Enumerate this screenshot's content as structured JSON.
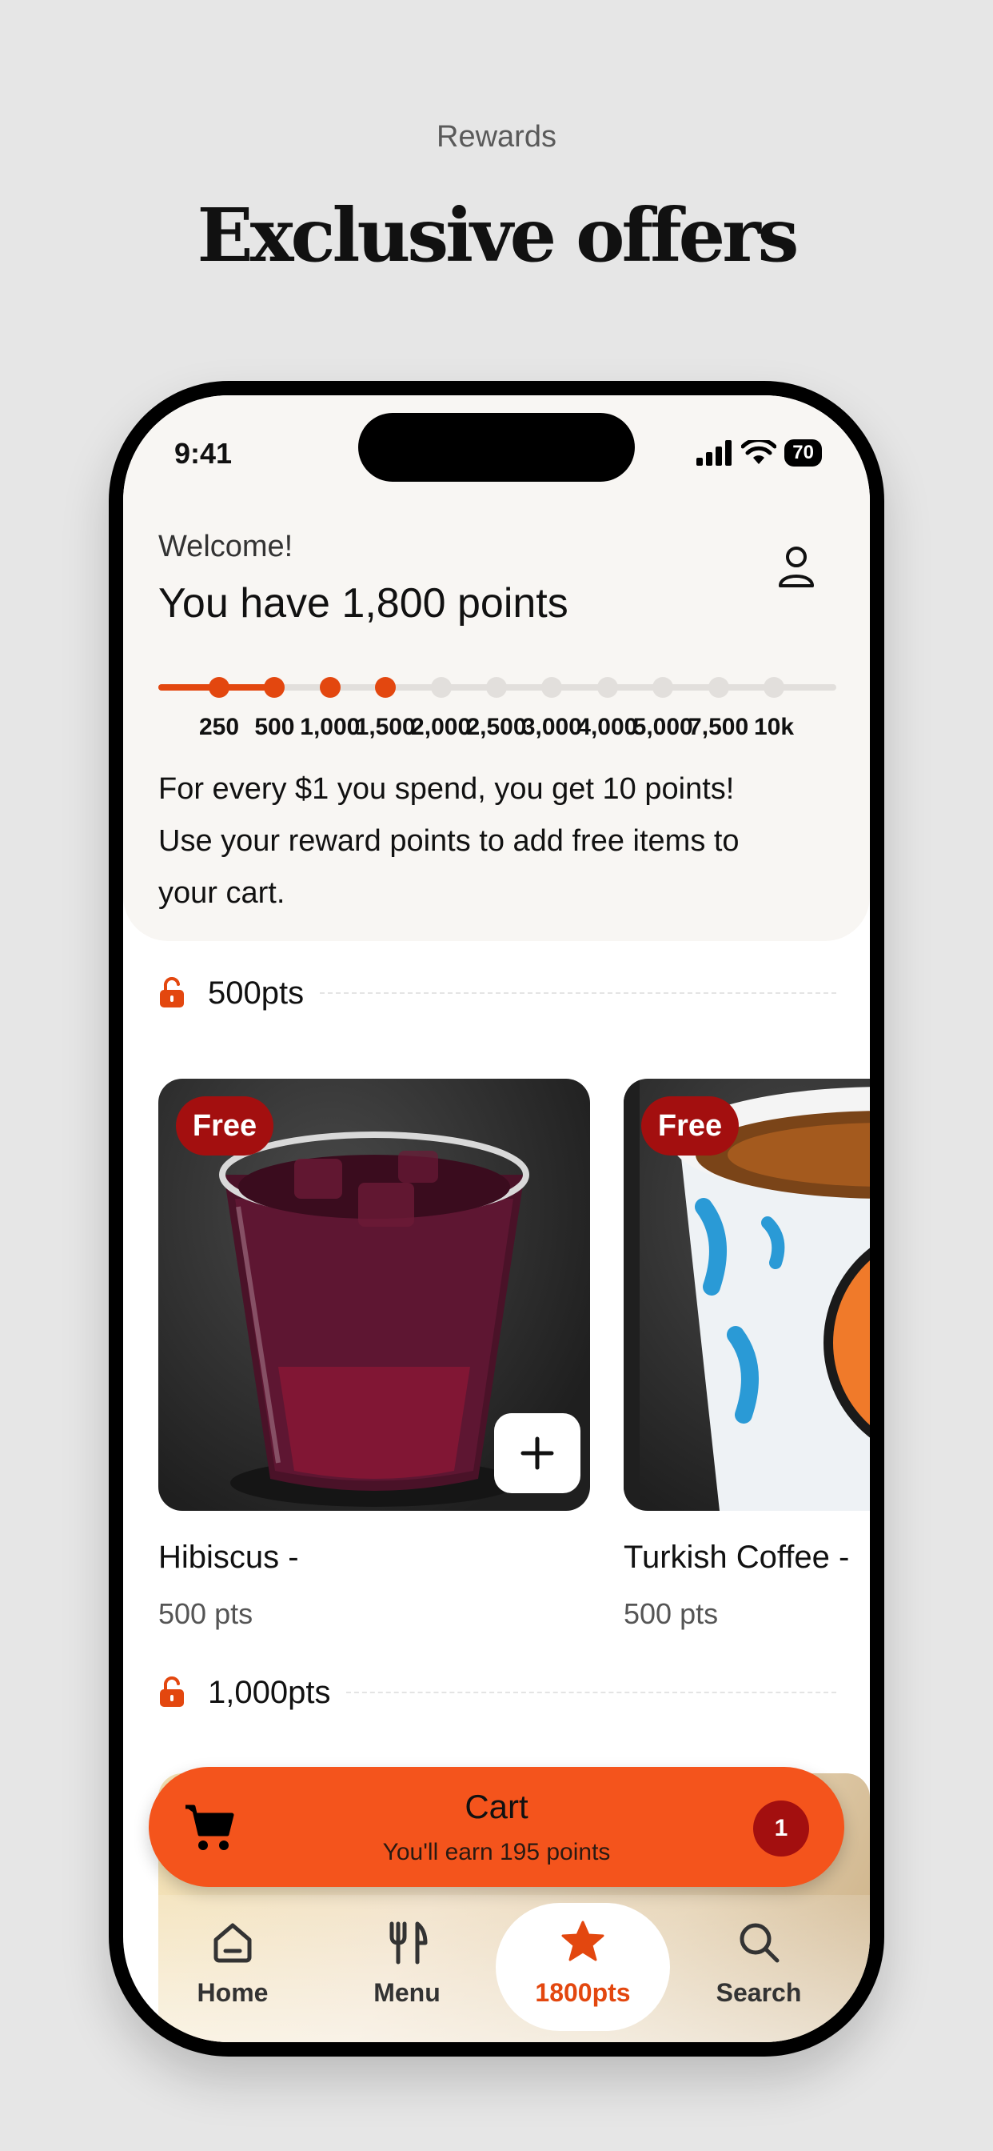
{
  "page": {
    "top_label": "Rewards",
    "headline": "Exclusive offers"
  },
  "status_bar": {
    "time": "9:41",
    "battery": "70"
  },
  "header": {
    "welcome": "Welcome!",
    "points_title": "You have 1,800 points",
    "progress_ticks": [
      "250",
      "500",
      "1,000",
      "1,500",
      "2,000",
      "2,500",
      "3,000",
      "4,000",
      "5,000",
      "7,500",
      "10k"
    ],
    "progress_reached_count": 4,
    "info_line_1": "For every $1 you spend, you get 10 points!",
    "info_line_2": "Use your reward points to add free items to",
    "info_line_3": "your cart."
  },
  "sections": [
    {
      "label": "500pts",
      "items": [
        {
          "badge": "Free",
          "name": "Hibiscus -",
          "points": "500 pts"
        },
        {
          "badge": "Free",
          "name": "Turkish Coffee -",
          "points": "500 pts"
        }
      ]
    },
    {
      "label": "1,000pts"
    }
  ],
  "cart": {
    "title": "Cart",
    "subtitle": "You'll earn 195 points",
    "count": "1"
  },
  "tabbar": {
    "items": [
      {
        "label": "Home",
        "icon": "home-icon"
      },
      {
        "label": "Menu",
        "icon": "fork-knife-icon"
      },
      {
        "label": "1800pts",
        "icon": "star-icon",
        "active": true
      },
      {
        "label": "Search",
        "icon": "search-icon"
      }
    ]
  },
  "colors": {
    "accent": "#e3470f",
    "cart_bg": "#f4541c",
    "badge": "#a30f0f",
    "header_bg": "#f8f6f3"
  }
}
